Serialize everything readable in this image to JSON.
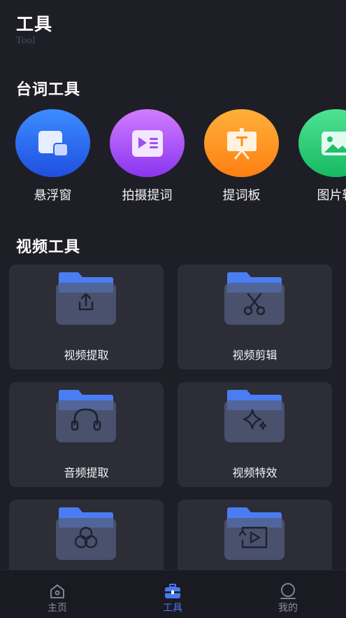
{
  "header": {
    "title": "工具",
    "subtitle": "Tool"
  },
  "lines_section": {
    "title": "台词工具",
    "items": [
      {
        "label": "悬浮窗",
        "icon": "floating-window-icon",
        "color_top": "#3d8dff",
        "color_bottom": "#1f4fe0"
      },
      {
        "label": "拍摄提词",
        "icon": "shoot-prompter-icon",
        "color_top": "#d27cff",
        "color_bottom": "#8a35f0"
      },
      {
        "label": "提词板",
        "icon": "prompter-board-icon",
        "color_top": "#ffb03a",
        "color_bottom": "#ff7f12"
      },
      {
        "label": "图片转",
        "icon": "image-convert-icon",
        "color_top": "#4ee394",
        "color_bottom": "#17b962"
      }
    ]
  },
  "video_section": {
    "title": "视频工具",
    "cards": [
      {
        "label": "视频提取",
        "icon": "upload-icon"
      },
      {
        "label": "视频剪辑",
        "icon": "scissors-icon"
      },
      {
        "label": "音频提取",
        "icon": "headphones-icon"
      },
      {
        "label": "视频特效",
        "icon": "sparkle-icon"
      },
      {
        "label": "",
        "icon": "color-circles-icon"
      },
      {
        "label": "",
        "icon": "video-replay-icon"
      }
    ]
  },
  "tabbar": {
    "items": [
      {
        "label": "主页",
        "icon": "home-icon",
        "active": false
      },
      {
        "label": "工具",
        "icon": "toolbox-icon",
        "active": true
      },
      {
        "label": "我的",
        "icon": "profile-icon",
        "active": false
      }
    ]
  },
  "colors": {
    "background": "#1e1f26",
    "card": "#2c2d37",
    "accent": "#4a78f0",
    "folder_tab": "#4b7df2"
  }
}
